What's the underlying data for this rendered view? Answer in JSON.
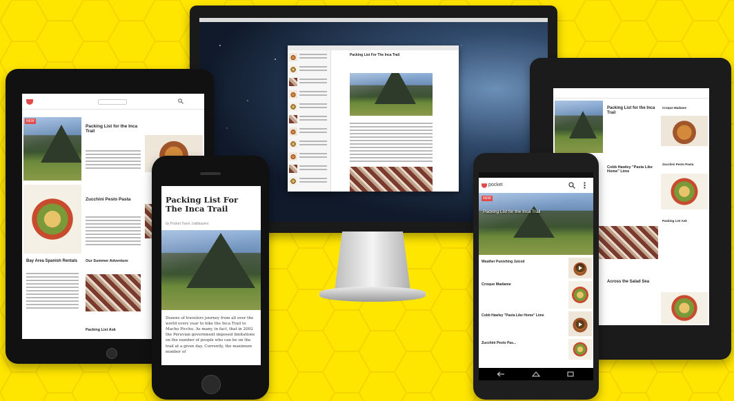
{
  "colors": {
    "background": "#ffe600",
    "accent": "#e34b4b",
    "device": "#111111"
  },
  "brand": {
    "name": "pocket"
  },
  "articles": {
    "inca": "Packing List for the Inca Trail",
    "inca_title": "Packing List For The Inca Trail",
    "inca_title_lower": "Packing List for the Inca Trail",
    "zucchini": "Zucchini Pesto Pasta",
    "zucchini_short": "Zucchini Pesto Pas...",
    "bay_area": "Bay Area Spanish Rentals",
    "summer": "Our Summer Adventure",
    "packing_short": "Packing List Ask",
    "croque": "Croque Madame",
    "cobb": "Cobb Hawley \"Pasta Like Home\" Lime",
    "weather": "Weather Punishing Juiced",
    "across_salad": "Across the Salad Sea",
    "packing_kit": "Packing List Ask"
  },
  "iphone": {
    "byline": "by Pocket Team, trailblazers",
    "body": "Dozens of travelers journey from all over the world every year to hike the Inca Trail to Machu Picchu. As many, in fact, that in 2002 the Peruvian government imposed limitations on the number of people who can be on the trail at a given day. Currently, the maximum number of"
  },
  "icons": [
    "pocket-logo-icon",
    "search-icon",
    "menu-icon",
    "play-icon",
    "back-icon",
    "home-icon",
    "recents-icon"
  ]
}
